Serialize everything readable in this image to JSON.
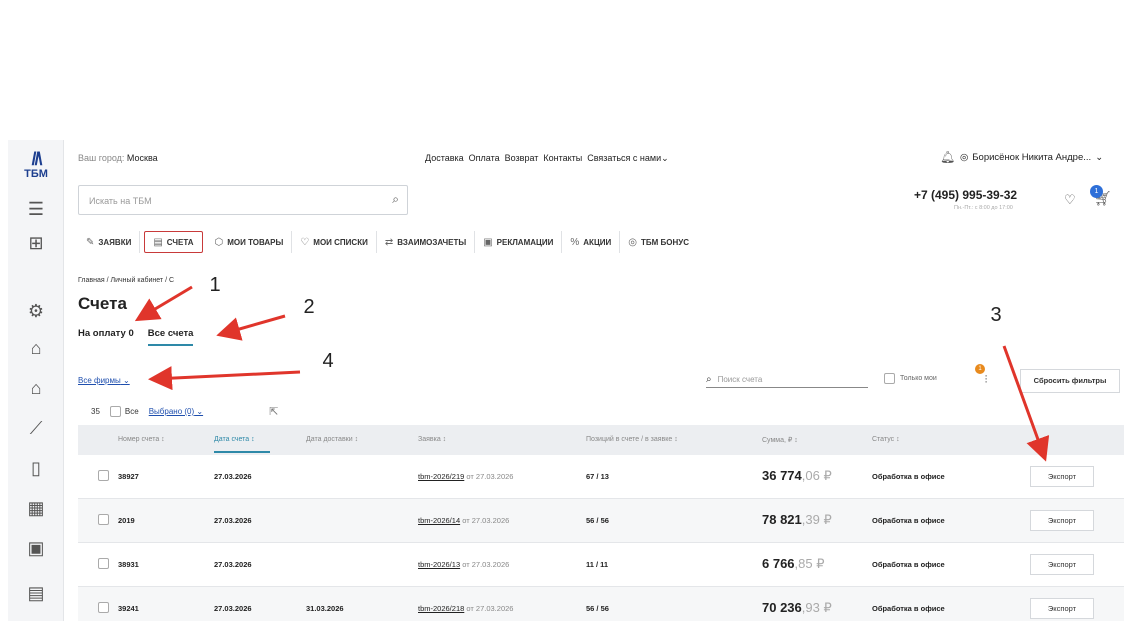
{
  "header": {
    "city_label": "Ваш город:",
    "city": "Москва",
    "nav": [
      "Доставка",
      "Оплата",
      "Возврат",
      "Контакты",
      "Связаться с нами"
    ],
    "nav_chevron": "⌄",
    "user_name": "Борисёнок Никита Андре...",
    "search_placeholder": "Искать на ТБМ",
    "phone": "+7 (495) 995-39-32",
    "hours": "Пн.-Пт.: с 8:00 до 17:00",
    "cart_count": "1"
  },
  "logo": {
    "mark": "//\\",
    "text": "ТБМ"
  },
  "tabs": [
    {
      "label": "ЗАЯВКИ",
      "icon": "edit-icon",
      "glyph": "✎"
    },
    {
      "label": "СЧЕТА",
      "icon": "document-icon",
      "glyph": "▤"
    },
    {
      "label": "МОИ ТОВАРЫ",
      "icon": "box-icon",
      "glyph": "⬡"
    },
    {
      "label": "МОИ СПИСКИ",
      "icon": "heart-icon",
      "glyph": "♡"
    },
    {
      "label": "ВЗАИМОЗАЧЕТЫ",
      "icon": "exchange-icon",
      "glyph": "⇄"
    },
    {
      "label": "РЕКЛАМАЦИИ",
      "icon": "complaint-icon",
      "glyph": "▣"
    },
    {
      "label": "АКЦИИ",
      "icon": "percent-icon",
      "glyph": "%"
    },
    {
      "label": "ТБМ БОНУС",
      "icon": "bonus-icon",
      "glyph": "◎"
    }
  ],
  "breadcrumbs": "Главная / Личный кабинет / С",
  "page_title": "Счета",
  "subtabs": [
    "На оплату 0",
    "Все счета"
  ],
  "firms_filter": "Все фирмы",
  "invoice_search_placeholder": "Поиск счета",
  "only_mine_label": "Только мои",
  "filter_badge": "1",
  "reset_filters": "Сбросить фильтры",
  "count": "35",
  "all_label": "Все",
  "selected_label": "Выбрано (0)",
  "columns": [
    "Номер счета ↕",
    "Дата счета ↕",
    "Дата доставки ↕",
    "Заявка ↕",
    "Позиций в счете / в заявке ↕",
    "Сумма, ₽ ↕",
    "Статус ↕"
  ],
  "rows": [
    {
      "number": "38927",
      "date": "27.03.2026",
      "delivery": "",
      "order": "tbm-2026/219",
      "order_from": "от 27.03.2026",
      "positions": "67 / 13",
      "sum_int": "36 774",
      "sum_dec": ",06 ₽",
      "status": "Обработка в офисе",
      "export": "Экспорт"
    },
    {
      "number": "2019",
      "date": "27.03.2026",
      "delivery": "",
      "order": "tbm-2026/14",
      "order_from": "от 27.03.2026",
      "positions": "56 / 56",
      "sum_int": "78 821",
      "sum_dec": ",39 ₽",
      "status": "Обработка в офисе",
      "export": "Экспорт"
    },
    {
      "number": "38931",
      "date": "27.03.2026",
      "delivery": "",
      "order": "tbm-2026/13",
      "order_from": "от 27.03.2026",
      "positions": "11 / 11",
      "sum_int": "6 766",
      "sum_dec": ",85 ₽",
      "status": "Обработка в офисе",
      "export": "Экспорт"
    },
    {
      "number": "39241",
      "date": "27.03.2026",
      "delivery": "31.03.2026",
      "order": "tbm-2026/218",
      "order_from": "от 27.03.2026",
      "positions": "56 / 56",
      "sum_int": "70 236",
      "sum_dec": ",93 ₽",
      "status": "Обработка в офисе",
      "export": "Экспорт"
    }
  ],
  "annotations": [
    "1",
    "2",
    "3",
    "4"
  ],
  "colors": {
    "accent": "#2e89a8",
    "arrow": "#e0352b",
    "brand": "#1d3f8f",
    "link": "#1f4fae"
  }
}
